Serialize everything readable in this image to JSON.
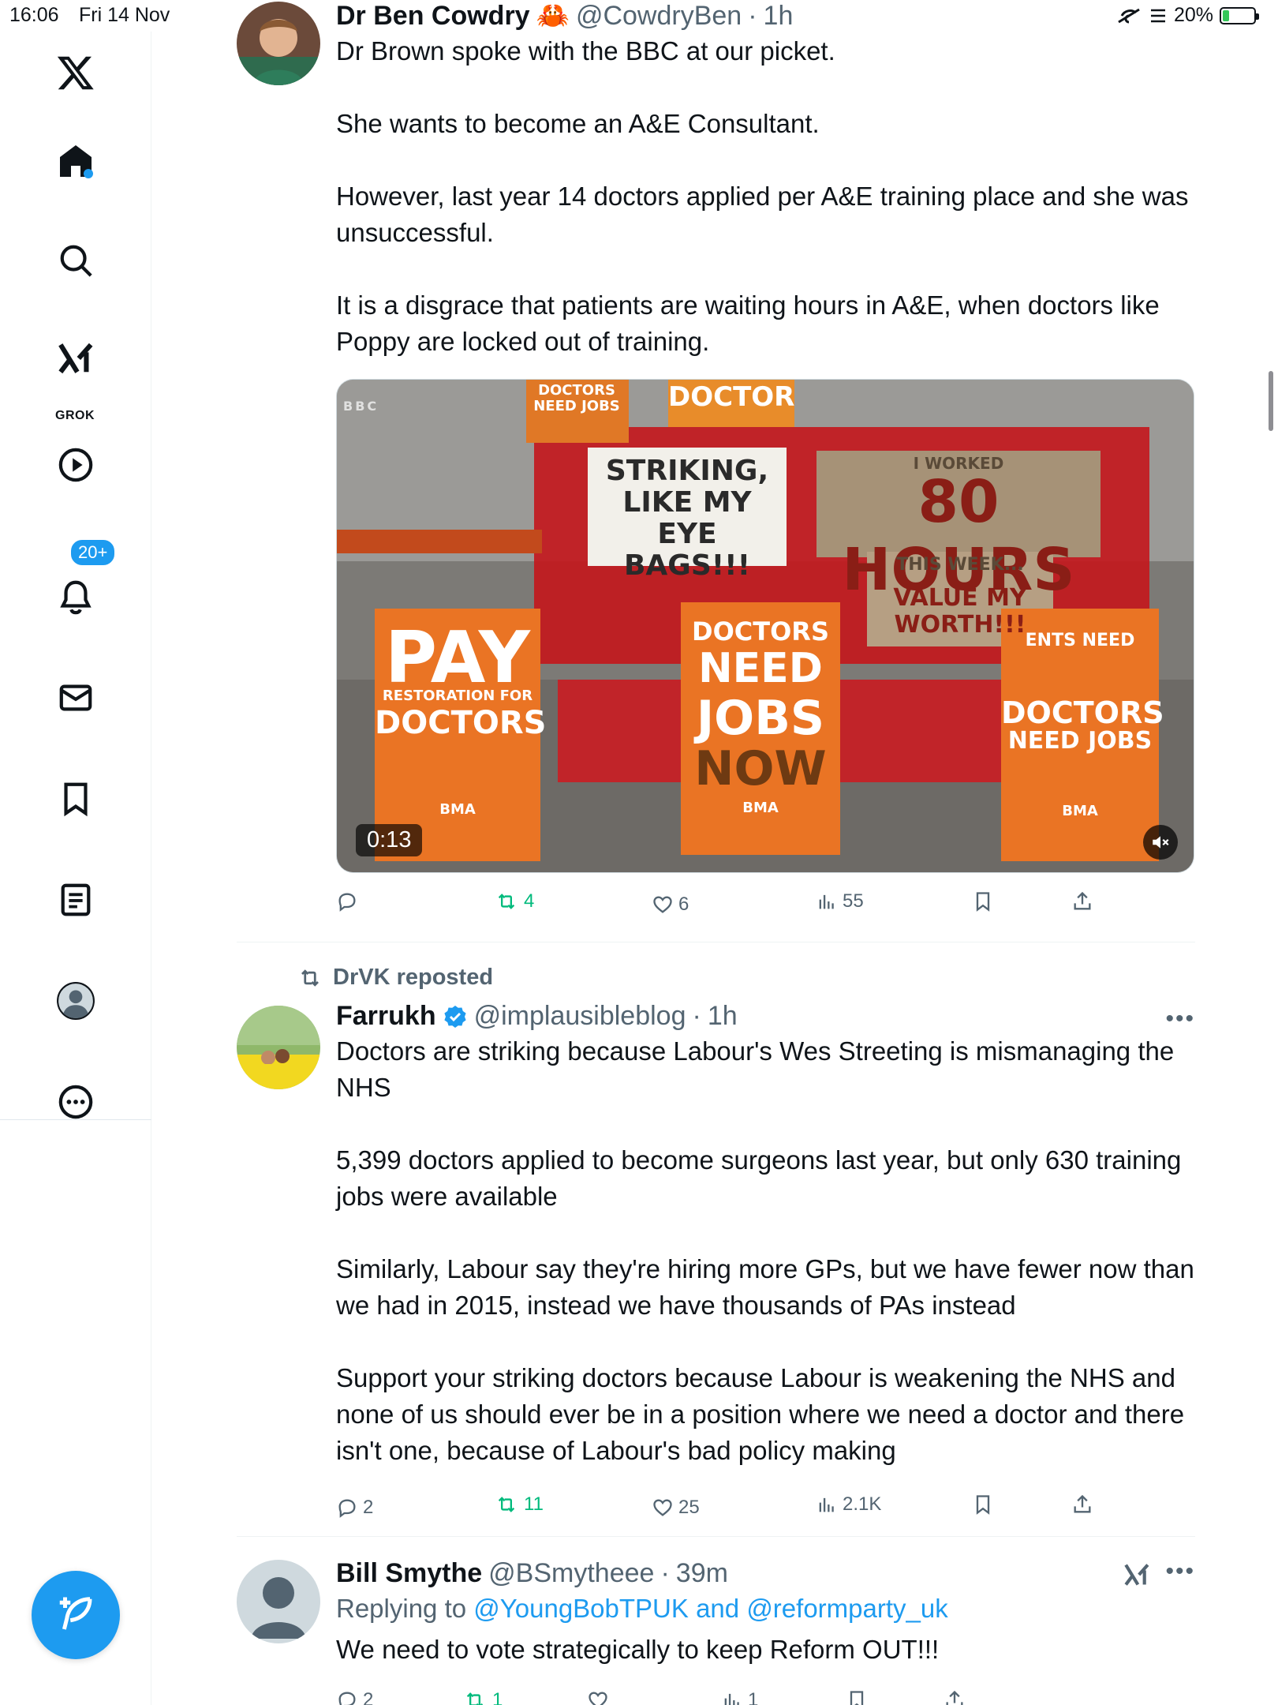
{
  "status_bar": {
    "time": "16:06",
    "date": "Fri 14 Nov",
    "battery": "20%",
    "battery_level": 0.2
  },
  "sidebar": {
    "items": [
      {
        "icon": "x-logo-icon",
        "label": ""
      },
      {
        "icon": "home-icon",
        "label": ""
      },
      {
        "icon": "search-icon",
        "label": ""
      },
      {
        "icon": "grok-icon",
        "label": "GROK"
      },
      {
        "icon": "video-icon",
        "label": ""
      },
      {
        "icon": "notifications-icon",
        "label": "",
        "badge": "20+"
      },
      {
        "icon": "messages-icon",
        "label": ""
      },
      {
        "icon": "bookmarks-icon",
        "label": ""
      },
      {
        "icon": "lists-icon",
        "label": ""
      },
      {
        "icon": "profile-icon",
        "label": ""
      },
      {
        "icon": "more-icon",
        "label": ""
      }
    ],
    "compose_icon": "compose-icon"
  },
  "tweets": [
    {
      "author": "Dr Ben Cowdry",
      "emoji": "🦀",
      "handle": "@CowdryBen",
      "dot": "·",
      "time": "1h",
      "text": "Dr Brown spoke with the BBC at our picket.\n\nShe wants to become an A&E Consultant.\n\nHowever, last year 14 doctors applied per A&E training place and she was unsuccessful.\n\nIt is a disgrace that patients are waiting hours in A&E, when doctors like Poppy are locked out of training.",
      "media": {
        "duration": "0:13",
        "watermark": "BBC",
        "signs": {
          "striking": "STRIKING, LIKE MY EYE BAGS!!!",
          "hours_top": "I WORKED",
          "hours": "80 HOURS",
          "hours_sub": "THIS WEEK...",
          "worth": "VALUE MY WORTH!!!",
          "pay": "PAY",
          "pay_sub": "RESTORATION FOR",
          "pay_doctors": "DOCTORS",
          "bma": "BMA",
          "jobs_1": "DOCTORS",
          "jobs_2": "NEED",
          "jobs_3": "JOBS",
          "jobs_4": "NOW",
          "right_top": "ENTS NEED",
          "right_1": "DOCTORS",
          "right_2": "NEED JOBS",
          "top_left": "DOCTORS NEED JOBS",
          "top_center": "DOCTOR"
        }
      },
      "actions": {
        "reply": "",
        "retweet": "4",
        "like": "6",
        "views": "55"
      }
    },
    {
      "reposted_by": "DrVK reposted",
      "author": "Farrukh",
      "verified": true,
      "handle": "@implausibleblog",
      "dot": "·",
      "time": "1h",
      "text": "Doctors are striking because Labour's Wes Streeting is mismanaging the NHS\n\n5,399 doctors applied to become surgeons last year, but only 630 training jobs were available\n\nSimilarly, Labour say they're hiring more GPs, but we have fewer now than we had in 2015, instead we have thousands of PAs instead\n\nSupport your striking doctors because Labour is weakening the NHS and none of us should ever be in a position where we need a doctor and there isn't one, because of Labour's bad policy making",
      "actions": {
        "reply": "2",
        "retweet": "11",
        "like": "25",
        "views": "2.1K"
      }
    },
    {
      "author": "Bill Smythe",
      "handle": "@BSmytheee",
      "dot": "·",
      "time": "39m",
      "replying_label": "Replying to",
      "replying_1": "@YoungBobTPUK",
      "replying_and": "and",
      "replying_2": "@reformparty_uk",
      "text": "We need to vote strategically to keep Reform OUT!!!",
      "actions": {
        "reply": "2",
        "retweet": "1",
        "like": "",
        "views": "1"
      }
    }
  ],
  "colors": {
    "accent": "#1d9bf0",
    "retweet": "#00ba7c",
    "muted": "#536471",
    "text": "#0f1419"
  }
}
